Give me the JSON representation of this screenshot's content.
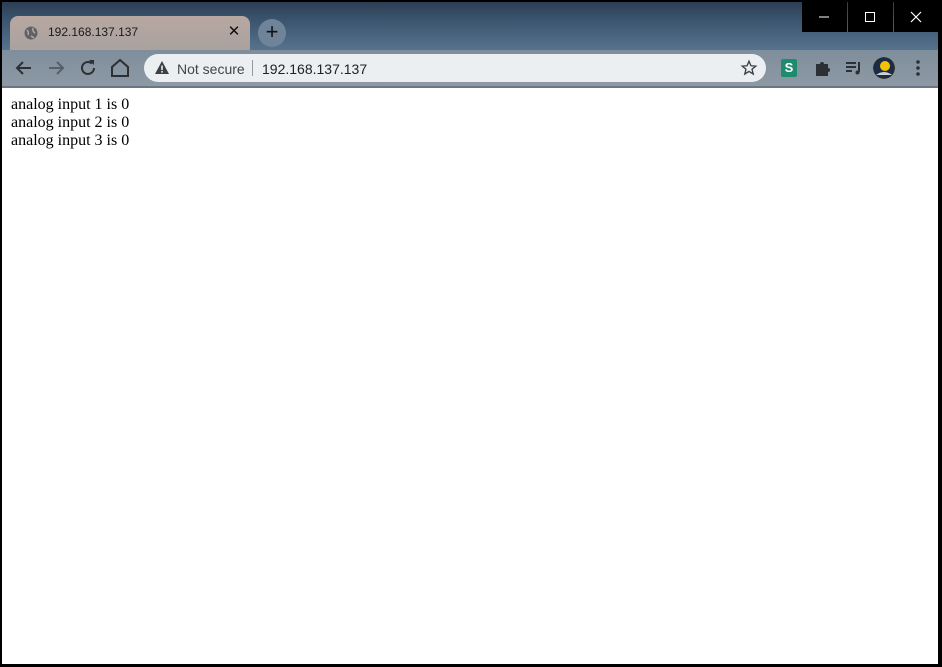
{
  "tab": {
    "title": "192.168.137.137",
    "close_label": "✕"
  },
  "new_tab_label": "+",
  "omnibox": {
    "security_label": "Not secure",
    "url": "192.168.137.137"
  },
  "extensions": [
    {
      "name": "s-extension-icon",
      "label": "S"
    }
  ],
  "content": {
    "lines": [
      "analog input 1 is 0",
      "analog input 2 is 0",
      "analog input 3 is 0"
    ]
  }
}
